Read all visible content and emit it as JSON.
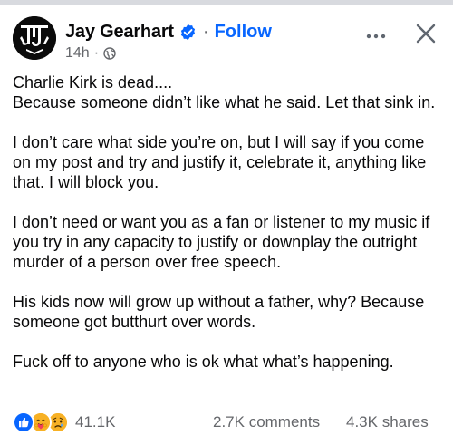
{
  "post": {
    "author": "Jay Gearhart",
    "follow_label": "Follow",
    "separator": "·",
    "timestamp": "14h",
    "meta_separator": "·",
    "audience_icon": "globe-icon",
    "paragraphs": [
      "Charlie Kirk is dead....\nBecause someone didn’t like what he said. Let that sink in.",
      "I don’t care what side you’re on, but I will say if you come on my post and try and justify it, celebrate it, anything like that. I will block you.",
      "I don’t need or want you as a fan or listener to my music if you try in any capacity to justify or downplay the outright murder of a person over free speech.",
      "His kids now will grow up without a father, why? Because someone got butthurt over words.",
      "Fuck off to anyone who is ok what what’s happening."
    ],
    "reaction_count": "41.1K",
    "comments_label": "2.7K comments",
    "shares_label": "4.3K shares"
  },
  "icons": {
    "avatar": "band-logo-avatar",
    "verified": "verified-badge-icon",
    "more": "more-options-icon",
    "close": "close-icon",
    "reactions": [
      "like-icon",
      "care-icon",
      "sad-icon"
    ]
  },
  "colors": {
    "link_blue": "#0866ff",
    "secondary_text": "#65676b",
    "primary_text": "#080809"
  }
}
